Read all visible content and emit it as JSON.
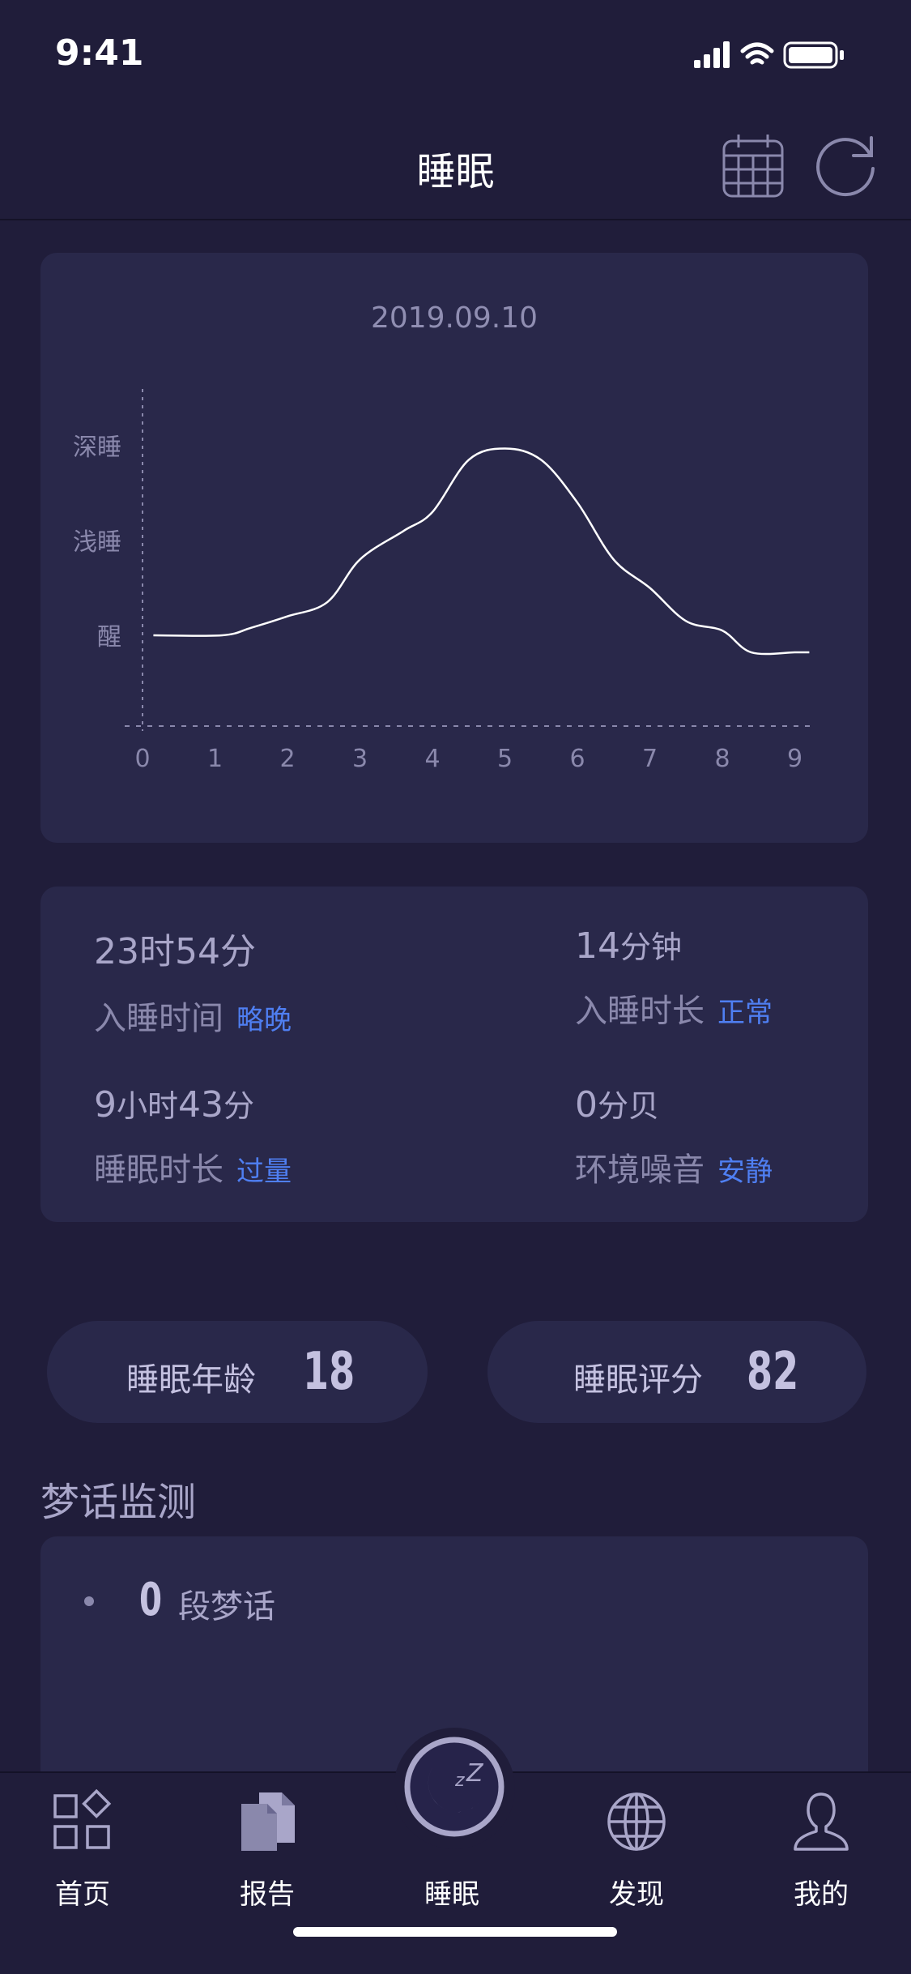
{
  "status_bar": {
    "time": "9:41"
  },
  "nav": {
    "title": "睡眠"
  },
  "chart_data": {
    "type": "line",
    "title": "2019.09.10",
    "y_categories": [
      "醒",
      "浅睡",
      "深睡"
    ],
    "x_ticks": [
      "0",
      "1",
      "2",
      "3",
      "4",
      "5",
      "6",
      "7",
      "8",
      "9"
    ],
    "series": [
      {
        "x": [
          0.15,
          1.1,
          1.5,
          2.0,
          2.55,
          3.0,
          3.6,
          4.0,
          4.5,
          5.0,
          5.5,
          6.0,
          6.5,
          7.0,
          7.5,
          8.0,
          8.4,
          9.0,
          9.2
        ],
        "values": [
          0.0,
          0.0,
          0.08,
          0.2,
          0.35,
          0.8,
          1.1,
          1.3,
          1.85,
          1.97,
          1.85,
          1.4,
          0.8,
          0.5,
          0.15,
          0.05,
          -0.18,
          -0.18,
          -0.18
        ]
      }
    ]
  },
  "stats": {
    "sleep_time": {
      "value": "23时54分",
      "label": "入睡时间",
      "tag": "略晚"
    },
    "fall_asleep": {
      "value_num": "14",
      "value_unit": "分钟",
      "label": "入睡时长",
      "tag": "正常"
    },
    "duration": {
      "v1": "9",
      "u1": "小时",
      "v2": "43",
      "u2": "分",
      "label": "睡眠时长",
      "tag": "过量"
    },
    "noise": {
      "value_num": "0",
      "value_unit": "分贝",
      "label": "环境噪音",
      "tag": "安静"
    }
  },
  "pills": {
    "age": {
      "label": "睡眠年龄",
      "value": "18"
    },
    "score": {
      "label": "睡眠评分",
      "value": "82"
    }
  },
  "dream": {
    "section_title": "梦话监测",
    "count": "0",
    "text": "段梦话"
  },
  "tabs": {
    "home": "首页",
    "report": "报告",
    "sleep": "睡眠",
    "discover": "发现",
    "me": "我的"
  }
}
